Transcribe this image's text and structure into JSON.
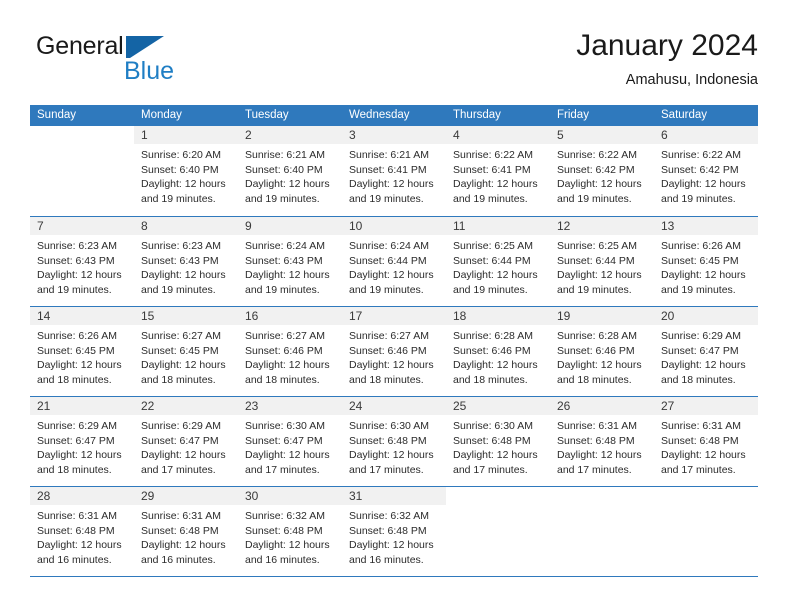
{
  "brand": {
    "name_part1": "General",
    "name_part2": "Blue",
    "logo_icon": "blue-flag-triangle"
  },
  "header": {
    "title": "January 2024",
    "subtitle": "Amahusu, Indonesia"
  },
  "calendar": {
    "weekday_headers": [
      "Sunday",
      "Monday",
      "Tuesday",
      "Wednesday",
      "Thursday",
      "Friday",
      "Saturday"
    ],
    "accent_color": "#2f79bd",
    "daynum_band_color": "#f1f1f1",
    "weeks": [
      [
        {
          "day": "",
          "blank": true,
          "sunrise": "",
          "sunset": "",
          "daylight1": "",
          "daylight2": ""
        },
        {
          "day": "1",
          "sunrise": "Sunrise: 6:20 AM",
          "sunset": "Sunset: 6:40 PM",
          "daylight1": "Daylight: 12 hours",
          "daylight2": "and 19 minutes."
        },
        {
          "day": "2",
          "sunrise": "Sunrise: 6:21 AM",
          "sunset": "Sunset: 6:40 PM",
          "daylight1": "Daylight: 12 hours",
          "daylight2": "and 19 minutes."
        },
        {
          "day": "3",
          "sunrise": "Sunrise: 6:21 AM",
          "sunset": "Sunset: 6:41 PM",
          "daylight1": "Daylight: 12 hours",
          "daylight2": "and 19 minutes."
        },
        {
          "day": "4",
          "sunrise": "Sunrise: 6:22 AM",
          "sunset": "Sunset: 6:41 PM",
          "daylight1": "Daylight: 12 hours",
          "daylight2": "and 19 minutes."
        },
        {
          "day": "5",
          "sunrise": "Sunrise: 6:22 AM",
          "sunset": "Sunset: 6:42 PM",
          "daylight1": "Daylight: 12 hours",
          "daylight2": "and 19 minutes."
        },
        {
          "day": "6",
          "sunrise": "Sunrise: 6:22 AM",
          "sunset": "Sunset: 6:42 PM",
          "daylight1": "Daylight: 12 hours",
          "daylight2": "and 19 minutes."
        }
      ],
      [
        {
          "day": "7",
          "sunrise": "Sunrise: 6:23 AM",
          "sunset": "Sunset: 6:43 PM",
          "daylight1": "Daylight: 12 hours",
          "daylight2": "and 19 minutes."
        },
        {
          "day": "8",
          "sunrise": "Sunrise: 6:23 AM",
          "sunset": "Sunset: 6:43 PM",
          "daylight1": "Daylight: 12 hours",
          "daylight2": "and 19 minutes."
        },
        {
          "day": "9",
          "sunrise": "Sunrise: 6:24 AM",
          "sunset": "Sunset: 6:43 PM",
          "daylight1": "Daylight: 12 hours",
          "daylight2": "and 19 minutes."
        },
        {
          "day": "10",
          "sunrise": "Sunrise: 6:24 AM",
          "sunset": "Sunset: 6:44 PM",
          "daylight1": "Daylight: 12 hours",
          "daylight2": "and 19 minutes."
        },
        {
          "day": "11",
          "sunrise": "Sunrise: 6:25 AM",
          "sunset": "Sunset: 6:44 PM",
          "daylight1": "Daylight: 12 hours",
          "daylight2": "and 19 minutes."
        },
        {
          "day": "12",
          "sunrise": "Sunrise: 6:25 AM",
          "sunset": "Sunset: 6:44 PM",
          "daylight1": "Daylight: 12 hours",
          "daylight2": "and 19 minutes."
        },
        {
          "day": "13",
          "sunrise": "Sunrise: 6:26 AM",
          "sunset": "Sunset: 6:45 PM",
          "daylight1": "Daylight: 12 hours",
          "daylight2": "and 19 minutes."
        }
      ],
      [
        {
          "day": "14",
          "sunrise": "Sunrise: 6:26 AM",
          "sunset": "Sunset: 6:45 PM",
          "daylight1": "Daylight: 12 hours",
          "daylight2": "and 18 minutes."
        },
        {
          "day": "15",
          "sunrise": "Sunrise: 6:27 AM",
          "sunset": "Sunset: 6:45 PM",
          "daylight1": "Daylight: 12 hours",
          "daylight2": "and 18 minutes."
        },
        {
          "day": "16",
          "sunrise": "Sunrise: 6:27 AM",
          "sunset": "Sunset: 6:46 PM",
          "daylight1": "Daylight: 12 hours",
          "daylight2": "and 18 minutes."
        },
        {
          "day": "17",
          "sunrise": "Sunrise: 6:27 AM",
          "sunset": "Sunset: 6:46 PM",
          "daylight1": "Daylight: 12 hours",
          "daylight2": "and 18 minutes."
        },
        {
          "day": "18",
          "sunrise": "Sunrise: 6:28 AM",
          "sunset": "Sunset: 6:46 PM",
          "daylight1": "Daylight: 12 hours",
          "daylight2": "and 18 minutes."
        },
        {
          "day": "19",
          "sunrise": "Sunrise: 6:28 AM",
          "sunset": "Sunset: 6:46 PM",
          "daylight1": "Daylight: 12 hours",
          "daylight2": "and 18 minutes."
        },
        {
          "day": "20",
          "sunrise": "Sunrise: 6:29 AM",
          "sunset": "Sunset: 6:47 PM",
          "daylight1": "Daylight: 12 hours",
          "daylight2": "and 18 minutes."
        }
      ],
      [
        {
          "day": "21",
          "sunrise": "Sunrise: 6:29 AM",
          "sunset": "Sunset: 6:47 PM",
          "daylight1": "Daylight: 12 hours",
          "daylight2": "and 18 minutes."
        },
        {
          "day": "22",
          "sunrise": "Sunrise: 6:29 AM",
          "sunset": "Sunset: 6:47 PM",
          "daylight1": "Daylight: 12 hours",
          "daylight2": "and 17 minutes."
        },
        {
          "day": "23",
          "sunrise": "Sunrise: 6:30 AM",
          "sunset": "Sunset: 6:47 PM",
          "daylight1": "Daylight: 12 hours",
          "daylight2": "and 17 minutes."
        },
        {
          "day": "24",
          "sunrise": "Sunrise: 6:30 AM",
          "sunset": "Sunset: 6:48 PM",
          "daylight1": "Daylight: 12 hours",
          "daylight2": "and 17 minutes."
        },
        {
          "day": "25",
          "sunrise": "Sunrise: 6:30 AM",
          "sunset": "Sunset: 6:48 PM",
          "daylight1": "Daylight: 12 hours",
          "daylight2": "and 17 minutes."
        },
        {
          "day": "26",
          "sunrise": "Sunrise: 6:31 AM",
          "sunset": "Sunset: 6:48 PM",
          "daylight1": "Daylight: 12 hours",
          "daylight2": "and 17 minutes."
        },
        {
          "day": "27",
          "sunrise": "Sunrise: 6:31 AM",
          "sunset": "Sunset: 6:48 PM",
          "daylight1": "Daylight: 12 hours",
          "daylight2": "and 17 minutes."
        }
      ],
      [
        {
          "day": "28",
          "sunrise": "Sunrise: 6:31 AM",
          "sunset": "Sunset: 6:48 PM",
          "daylight1": "Daylight: 12 hours",
          "daylight2": "and 16 minutes."
        },
        {
          "day": "29",
          "sunrise": "Sunrise: 6:31 AM",
          "sunset": "Sunset: 6:48 PM",
          "daylight1": "Daylight: 12 hours",
          "daylight2": "and 16 minutes."
        },
        {
          "day": "30",
          "sunrise": "Sunrise: 6:32 AM",
          "sunset": "Sunset: 6:48 PM",
          "daylight1": "Daylight: 12 hours",
          "daylight2": "and 16 minutes."
        },
        {
          "day": "31",
          "sunrise": "Sunrise: 6:32 AM",
          "sunset": "Sunset: 6:48 PM",
          "daylight1": "Daylight: 12 hours",
          "daylight2": "and 16 minutes."
        },
        {
          "day": "",
          "blank": true,
          "sunrise": "",
          "sunset": "",
          "daylight1": "",
          "daylight2": ""
        },
        {
          "day": "",
          "blank": true,
          "sunrise": "",
          "sunset": "",
          "daylight1": "",
          "daylight2": ""
        },
        {
          "day": "",
          "blank": true,
          "sunrise": "",
          "sunset": "",
          "daylight1": "",
          "daylight2": ""
        }
      ]
    ]
  }
}
